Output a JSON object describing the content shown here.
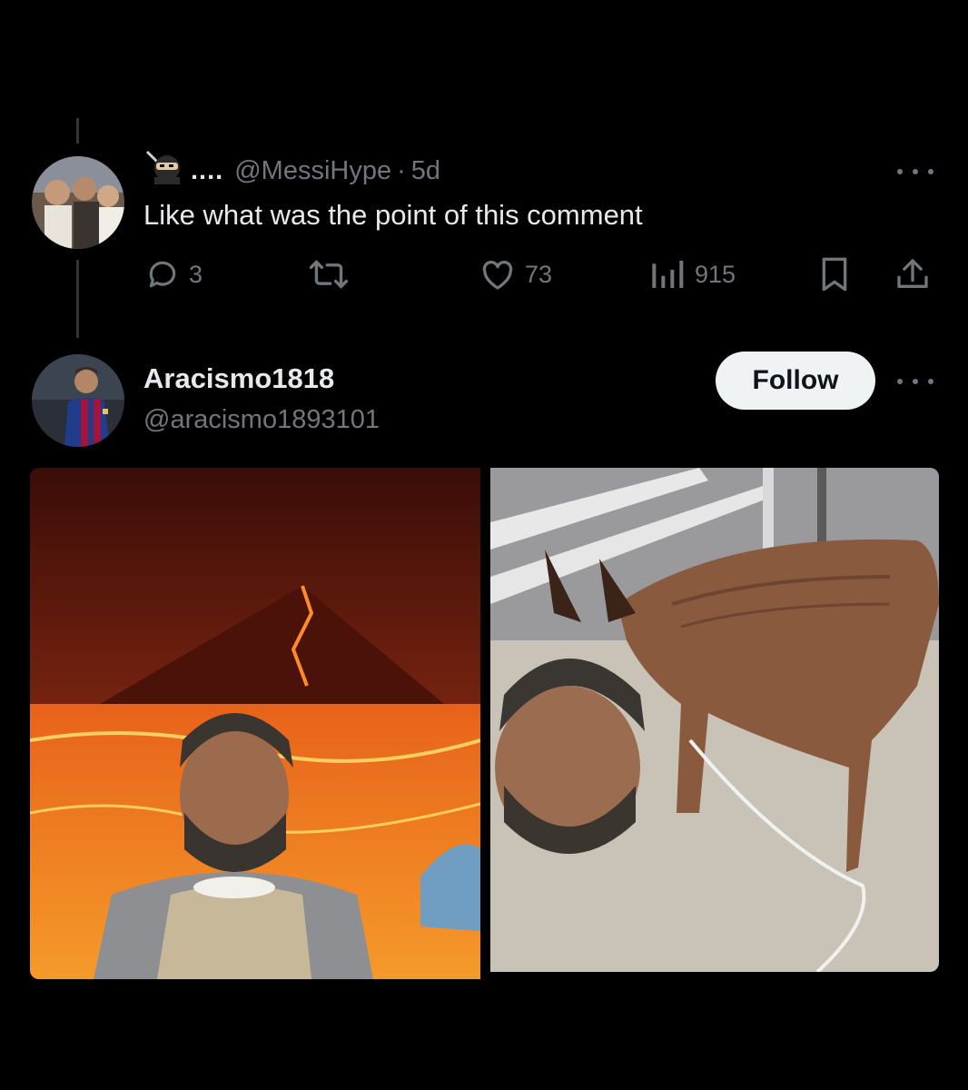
{
  "reply": {
    "display_name": "....",
    "handle": "@MessiHype",
    "separator": "·",
    "time": "5d",
    "text": "Like what was the point of this comment",
    "stats": {
      "replies": "3",
      "likes": "73",
      "views": "915"
    }
  },
  "suggested_user": {
    "name": "Aracismo1818",
    "handle": "@aracismo1893101",
    "follow_label": "Follow"
  },
  "icons": {
    "reply": "reply-icon",
    "retweet": "retweet-icon",
    "like": "heart-icon",
    "views": "views-icon",
    "bookmark": "bookmark-icon",
    "share": "share-icon",
    "more": "more-icon"
  },
  "colors": {
    "background": "#000000",
    "text_primary": "#e7e9ea",
    "text_secondary": "#71767b",
    "follow_button_bg": "#eff3f4"
  }
}
